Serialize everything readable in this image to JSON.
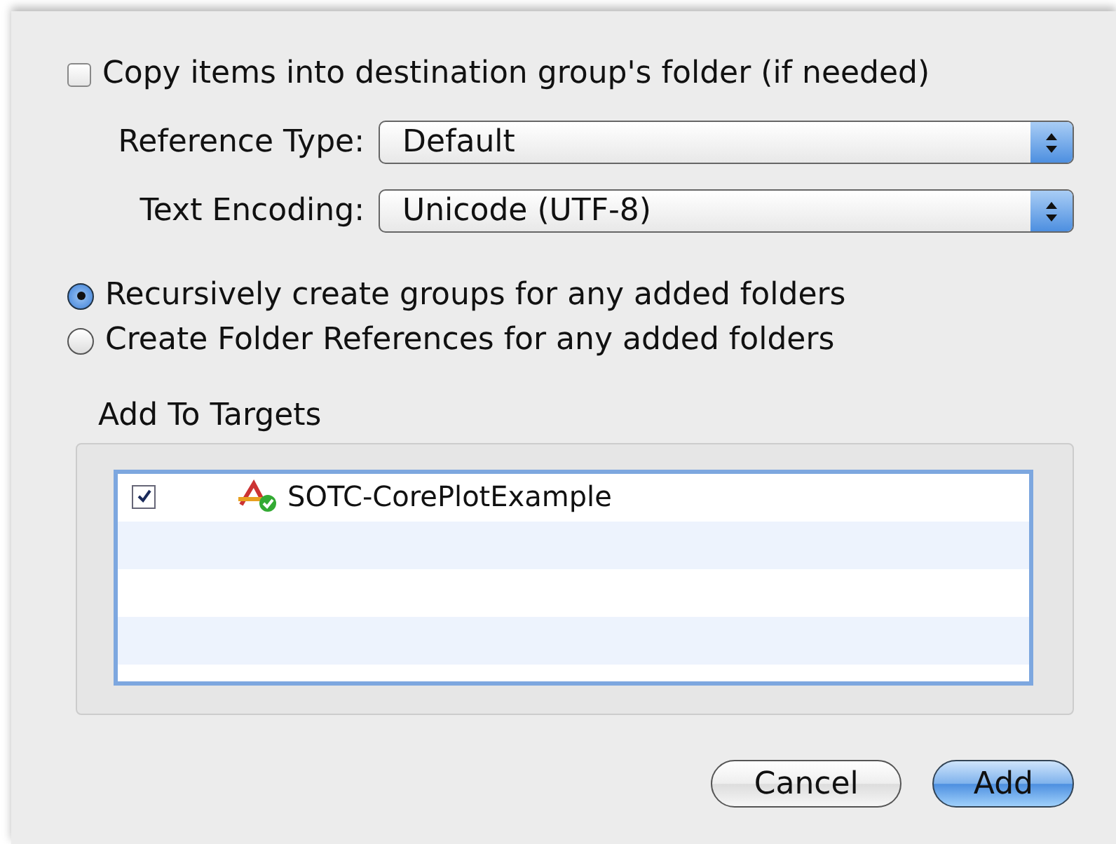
{
  "copy_items": {
    "label": "Copy items into destination group's folder (if needed)",
    "checked": false
  },
  "popups": [
    {
      "label": "Reference Type:",
      "value": "Default"
    },
    {
      "label": "Text Encoding:",
      "value": "Unicode (UTF-8)"
    }
  ],
  "group_options": [
    {
      "label": "Recursively create groups for any added folders",
      "selected": true
    },
    {
      "label": "Create Folder References for any added folders",
      "selected": false
    }
  ],
  "targets": {
    "title": "Add To Targets",
    "items": [
      {
        "name": "SOTC-CorePlotExample",
        "checked": true
      }
    ]
  },
  "buttons": [
    {
      "label": "Cancel",
      "default": false
    },
    {
      "label": "Add",
      "default": true
    }
  ]
}
